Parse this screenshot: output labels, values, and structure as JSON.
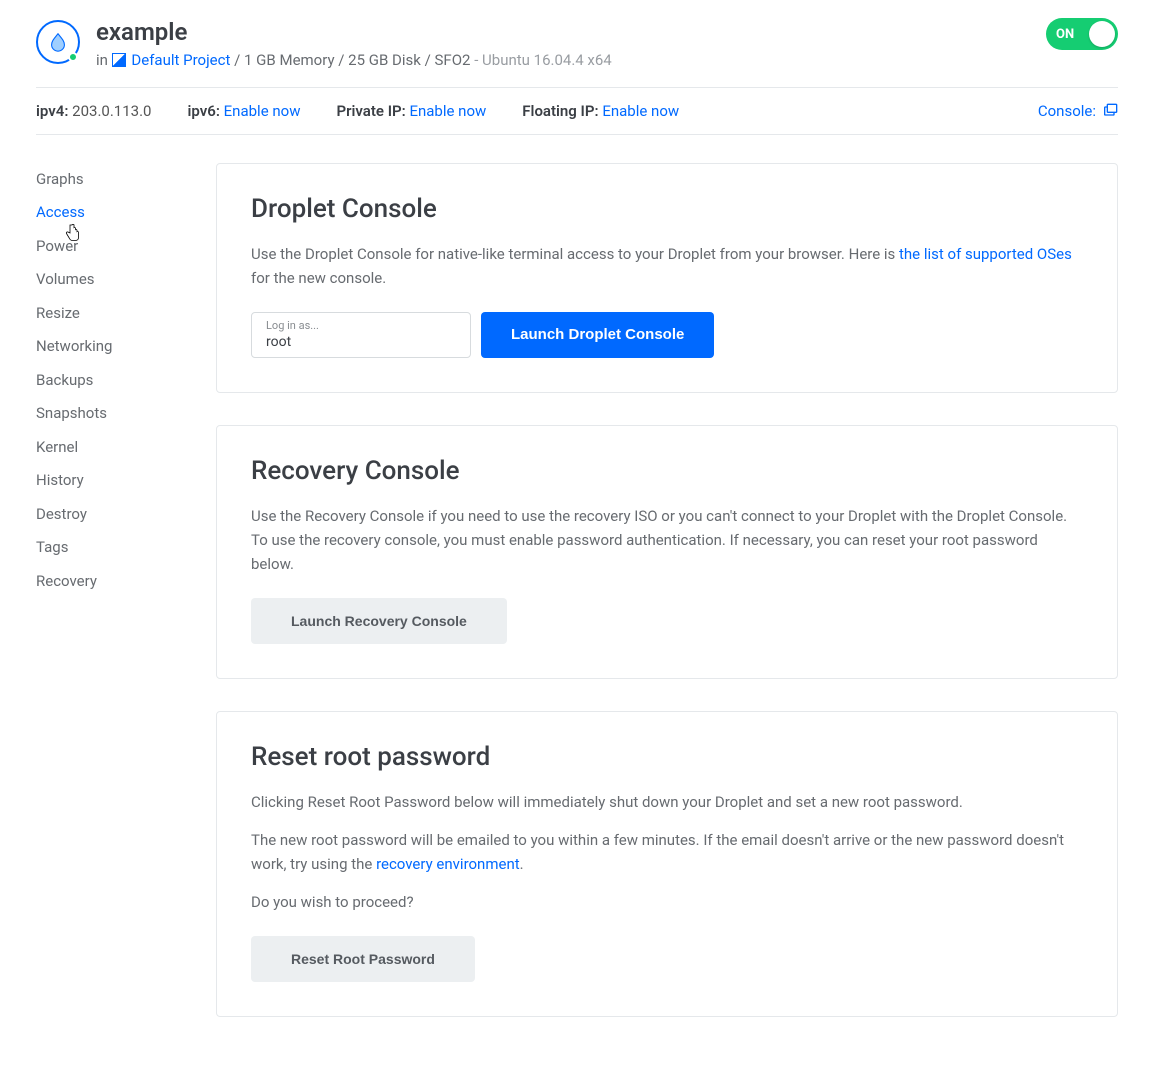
{
  "header": {
    "title": "example",
    "in": "in",
    "project_link": "Default Project",
    "specs": "/ 1 GB Memory / 25 GB Disk / SFO2",
    "os": "- Ubuntu 16.04.4 x64",
    "toggle_label": "ON"
  },
  "infobar": {
    "ipv4_label": "ipv4:",
    "ipv4_value": "203.0.113.0",
    "ipv6_label": "ipv6:",
    "ipv6_link": "Enable now",
    "private_ip_label": "Private IP:",
    "private_ip_link": "Enable now",
    "floating_ip_label": "Floating IP:",
    "floating_ip_link": "Enable now",
    "console_label": "Console:"
  },
  "sidebar": {
    "items": [
      {
        "label": "Graphs"
      },
      {
        "label": "Access",
        "active": true
      },
      {
        "label": "Power"
      },
      {
        "label": "Volumes"
      },
      {
        "label": "Resize"
      },
      {
        "label": "Networking"
      },
      {
        "label": "Backups"
      },
      {
        "label": "Snapshots"
      },
      {
        "label": "Kernel"
      },
      {
        "label": "History"
      },
      {
        "label": "Destroy"
      },
      {
        "label": "Tags"
      },
      {
        "label": "Recovery"
      }
    ]
  },
  "cards": {
    "droplet_console": {
      "title": "Droplet Console",
      "desc_pre": "Use the Droplet Console for native-like terminal access to your Droplet from your browser. Here is ",
      "link": "the list of supported OSes",
      "desc_post": " for the new console.",
      "login_label": "Log in as...",
      "login_value": "root",
      "button": "Launch Droplet Console"
    },
    "recovery_console": {
      "title": "Recovery Console",
      "desc": "Use the Recovery Console if you need to use the recovery ISO or you can't connect to your Droplet with the Droplet Console. To use the recovery console, you must enable password authentication. If necessary, you can reset your root password below.",
      "button": "Launch Recovery Console"
    },
    "reset_root": {
      "title": "Reset root password",
      "p1": "Clicking Reset Root Password below will immediately shut down your Droplet and set a new root password.",
      "p2_pre": "The new root password will be emailed to you within a few minutes. If the email doesn't arrive or the new password doesn't work, try using the ",
      "p2_link": "recovery environment",
      "p2_post": ".",
      "confirm": "Do you wish to proceed?",
      "button": "Reset Root Password"
    }
  }
}
